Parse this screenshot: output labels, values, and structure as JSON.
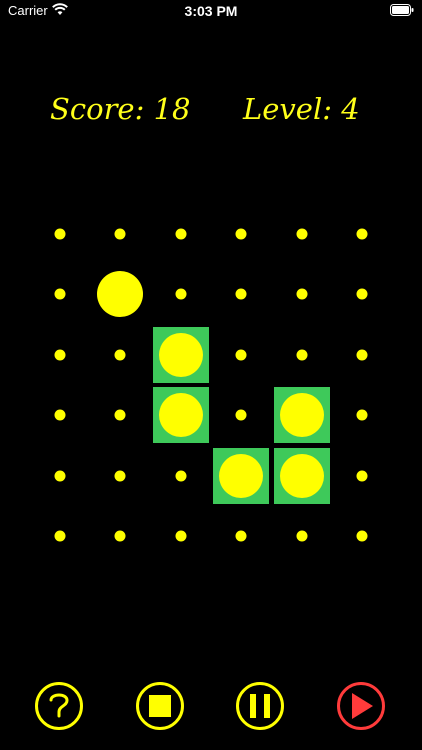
{
  "status_bar": {
    "carrier": "Carrier",
    "time": "3:03 PM"
  },
  "hud": {
    "score": "Score: 18",
    "level": "Level: 4"
  },
  "board": {
    "rows": 6,
    "cols": 6,
    "dot_color": "#ffff00",
    "tile_color": "#3ec95a",
    "tiles": [
      {
        "row": 2,
        "col": 2
      },
      {
        "row": 3,
        "col": 2
      },
      {
        "row": 3,
        "col": 4
      },
      {
        "row": 4,
        "col": 3
      },
      {
        "row": 4,
        "col": 4
      }
    ],
    "free_ball": {
      "row": 1,
      "col": 1
    }
  },
  "controls": [
    {
      "name": "help-button",
      "icon": "question-icon"
    },
    {
      "name": "stop-button",
      "icon": "stop-icon"
    },
    {
      "name": "pause-button",
      "icon": "pause-icon"
    },
    {
      "name": "play-button",
      "icon": "play-icon"
    }
  ],
  "colors": {
    "accent": "#ffff00",
    "play": "#ff3b3b",
    "background": "#000000"
  }
}
